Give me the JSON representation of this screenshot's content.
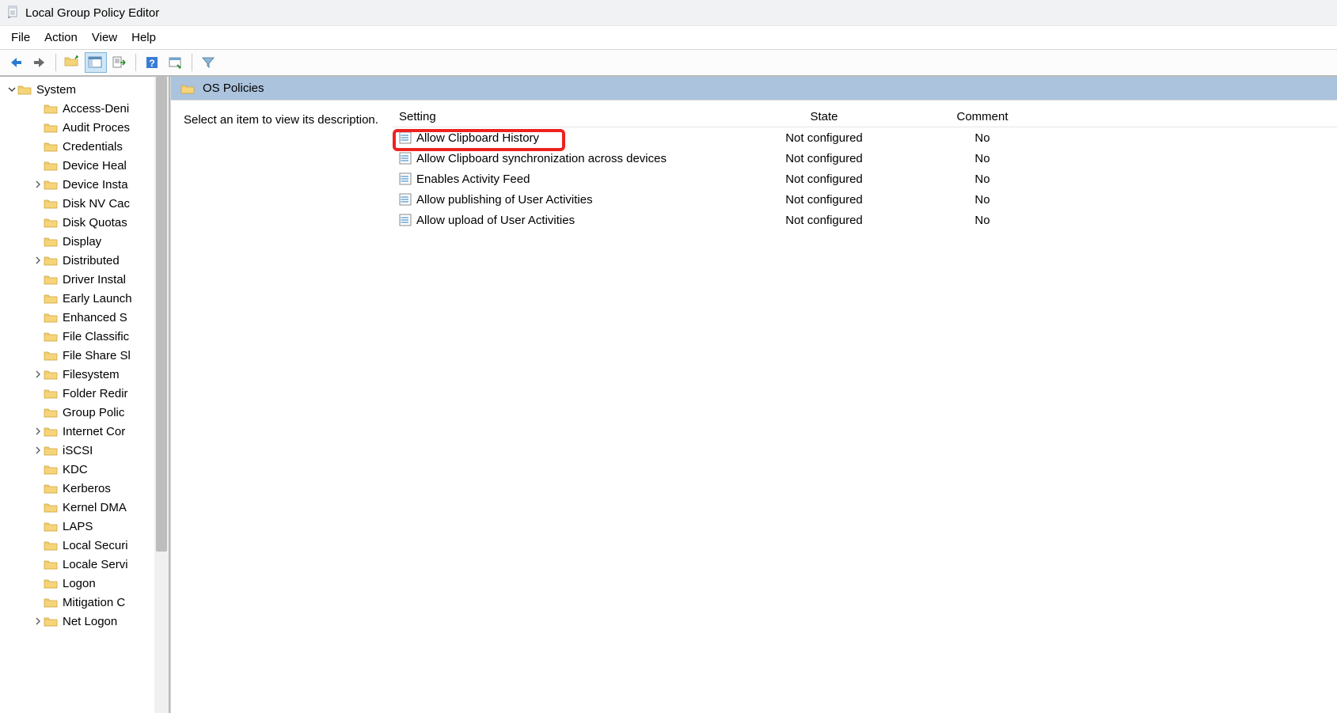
{
  "title": "Local Group Policy Editor",
  "menu": {
    "file": "File",
    "action": "Action",
    "view": "View",
    "help": "Help"
  },
  "tree": {
    "root": {
      "label": "System",
      "expanded": true
    },
    "children": [
      {
        "label": "Access-Deni",
        "expander": ""
      },
      {
        "label": "Audit Proces",
        "expander": ""
      },
      {
        "label": "Credentials",
        "expander": ""
      },
      {
        "label": "Device Heal",
        "expander": ""
      },
      {
        "label": "Device Insta",
        "expander": ">"
      },
      {
        "label": "Disk NV Cac",
        "expander": ""
      },
      {
        "label": "Disk Quotas",
        "expander": ""
      },
      {
        "label": "Display",
        "expander": ""
      },
      {
        "label": "Distributed",
        "expander": ">"
      },
      {
        "label": "Driver Instal",
        "expander": ""
      },
      {
        "label": "Early Launch",
        "expander": ""
      },
      {
        "label": "Enhanced S",
        "expander": ""
      },
      {
        "label": "File Classific",
        "expander": ""
      },
      {
        "label": "File Share Sl",
        "expander": ""
      },
      {
        "label": "Filesystem",
        "expander": ">"
      },
      {
        "label": "Folder Redir",
        "expander": ""
      },
      {
        "label": "Group Polic",
        "expander": ""
      },
      {
        "label": "Internet Cor",
        "expander": ">"
      },
      {
        "label": "iSCSI",
        "expander": ">"
      },
      {
        "label": "KDC",
        "expander": ""
      },
      {
        "label": "Kerberos",
        "expander": ""
      },
      {
        "label": "Kernel DMA",
        "expander": ""
      },
      {
        "label": "LAPS",
        "expander": ""
      },
      {
        "label": "Local Securi",
        "expander": ""
      },
      {
        "label": "Locale Servi",
        "expander": ""
      },
      {
        "label": "Logon",
        "expander": ""
      },
      {
        "label": "Mitigation C",
        "expander": ""
      },
      {
        "label": "Net Logon",
        "expander": ">"
      }
    ]
  },
  "right": {
    "header": "OS Policies",
    "description_placeholder": "Select an item to view its description.",
    "columns": {
      "setting": "Setting",
      "state": "State",
      "comment": "Comment"
    },
    "rows": [
      {
        "setting": "Allow Clipboard History",
        "state": "Not configured",
        "comment": "No",
        "highlight": true
      },
      {
        "setting": "Allow Clipboard synchronization across devices",
        "state": "Not configured",
        "comment": "No"
      },
      {
        "setting": "Enables Activity Feed",
        "state": "Not configured",
        "comment": "No"
      },
      {
        "setting": "Allow publishing of User Activities",
        "state": "Not configured",
        "comment": "No"
      },
      {
        "setting": "Allow upload of User Activities",
        "state": "Not configured",
        "comment": "No"
      }
    ]
  }
}
